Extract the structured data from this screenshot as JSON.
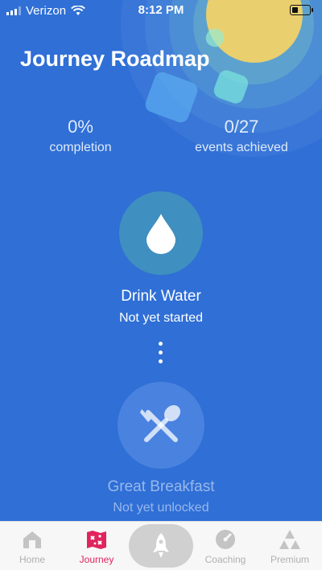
{
  "status_bar": {
    "carrier": "Verizon",
    "time": "8:12 PM",
    "battery_level": 0.35
  },
  "header": {
    "title": "Journey Roadmap"
  },
  "stats": [
    {
      "value": "0%",
      "label": "completion"
    },
    {
      "value": "0/27",
      "label": "events achieved"
    }
  ],
  "milestones": [
    {
      "title": "Drink Water",
      "status": "Not yet started",
      "icon": "water-drop-icon"
    },
    {
      "title": "Great Breakfast",
      "status": "Not yet unlocked",
      "icon": "fork-spoon-icon"
    }
  ],
  "tabs": [
    {
      "label": "Home",
      "icon": "home-icon",
      "active": false
    },
    {
      "label": "Journey",
      "icon": "map-icon",
      "active": true
    },
    {
      "label": "",
      "icon": "rocket-icon",
      "active": false
    },
    {
      "label": "Coaching",
      "icon": "gauge-icon",
      "active": false
    },
    {
      "label": "Premium",
      "icon": "triangles-icon",
      "active": false
    }
  ],
  "colors": {
    "background": "#2f6fd6",
    "accent_active": "#e0245e",
    "sun": "#e9cf6e"
  }
}
